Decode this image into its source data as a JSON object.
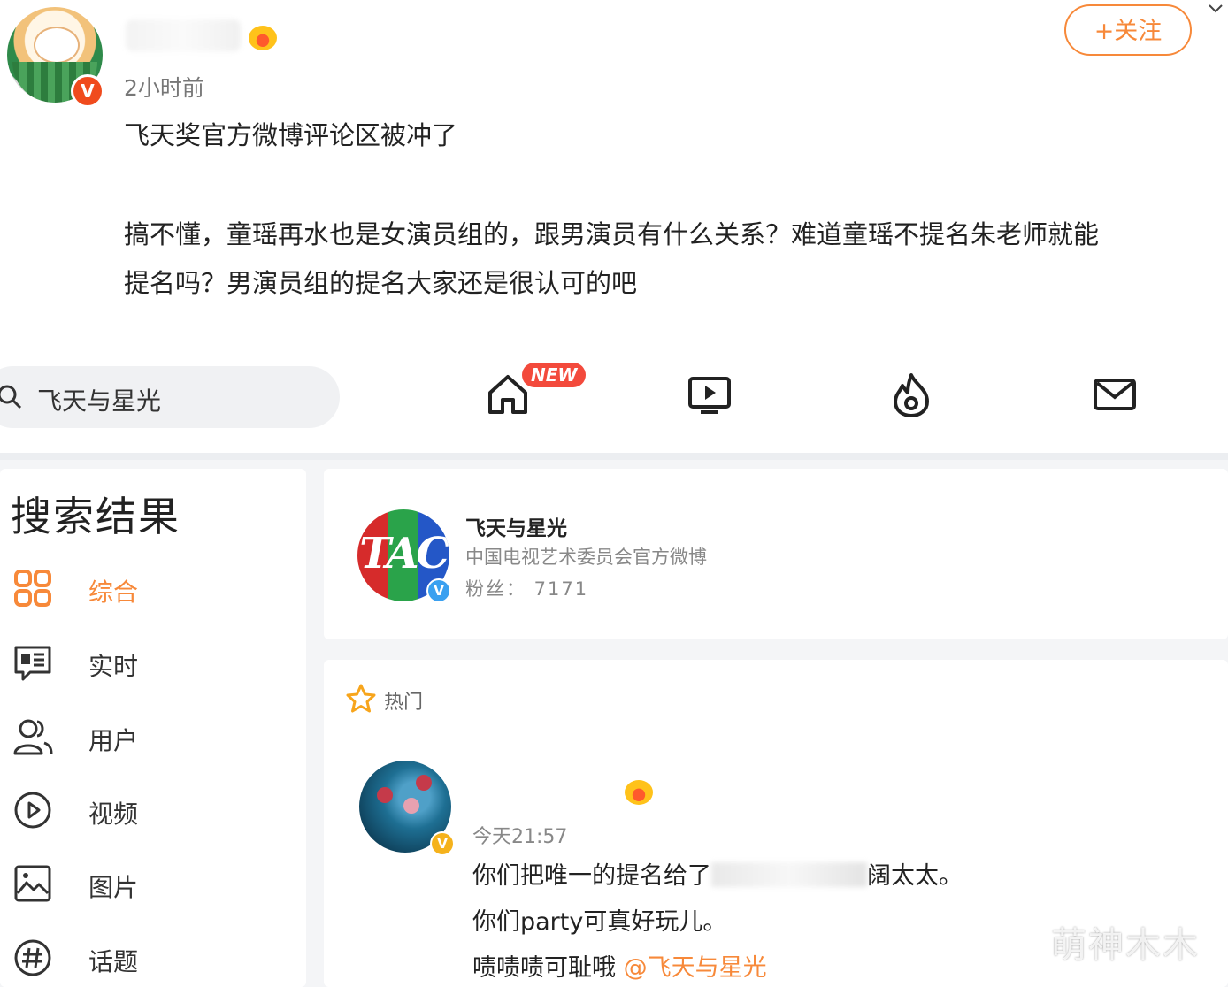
{
  "post": {
    "time": "2小时前",
    "line1": "飞天奖官方微博评论区被冲了",
    "line2": "搞不懂，童瑶再水也是女演员组的，跟男演员有什么关系？难道童瑶不提名朱老师就能",
    "line3": "提名吗？男演员组的提名大家还是很认可的吧",
    "follow_label": "+关注",
    "badge": "V"
  },
  "nav": {
    "search_placeholder": "飞天与星光",
    "new_badge": "NEW",
    "icons": [
      "home-icon",
      "video-icon",
      "hot-icon",
      "mail-icon"
    ]
  },
  "sidebar": {
    "title": "搜索结果",
    "items": [
      {
        "label": "综合",
        "icon": "grid-icon",
        "active": true
      },
      {
        "label": "实时",
        "icon": "realtime-icon",
        "active": false
      },
      {
        "label": "用户",
        "icon": "users-icon",
        "active": false
      },
      {
        "label": "视频",
        "icon": "play-icon",
        "active": false
      },
      {
        "label": "图片",
        "icon": "image-icon",
        "active": false
      },
      {
        "label": "话题",
        "icon": "hashtag-icon",
        "active": false
      }
    ]
  },
  "user_card": {
    "logo_text": "TAC",
    "name": "飞天与星光",
    "description": "中国电视艺术委员会官方微博",
    "fans": "粉丝： 7171"
  },
  "feed": {
    "section_label": "热门",
    "time": "今天21:57",
    "line1_before": "你们把唯一的提名给了",
    "line1_after": "阔太太。",
    "line2": "你们party可真好玩儿。",
    "line3_text": "啧啧啧可耻哦",
    "line3_mention": "@飞天与星光"
  },
  "watermark": "萌神木木",
  "colors": {
    "accent": "#f7893a",
    "verified_red": "#f04b1d",
    "verified_blue": "#3aa0f0",
    "new_badge": "#f34a3c"
  }
}
